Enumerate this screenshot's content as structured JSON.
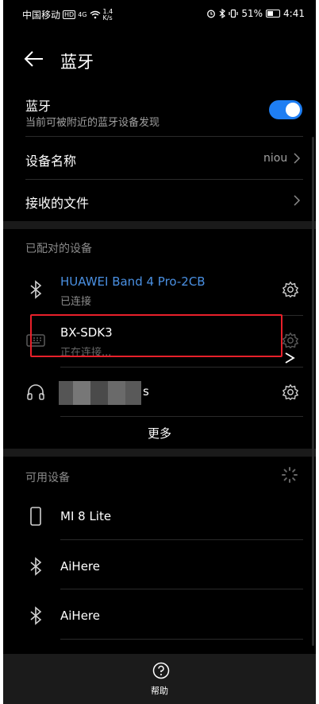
{
  "status_bar": {
    "carrier": "中国移动",
    "hd": "HD",
    "network": "4G",
    "speed_value": "1.4",
    "speed_unit": "K/s",
    "battery": "51%",
    "time": "4:41"
  },
  "header": {
    "title": "蓝牙"
  },
  "bluetooth_toggle": {
    "label": "蓝牙",
    "description": "当前可被附近的蓝牙设备发现",
    "enabled": true
  },
  "device_name": {
    "label": "设备名称",
    "value": "niou"
  },
  "received_files": {
    "label": "接收的文件"
  },
  "paired": {
    "title": "已配对的设备",
    "devices": [
      {
        "name": "HUAWEI Band 4 Pro-2CB",
        "status": "已连接",
        "icon": "bluetooth-icon",
        "color": "#4a90e2"
      },
      {
        "name": "BX-SDK3",
        "status": "正在连接...",
        "icon": "keyboard-icon",
        "color": "#ffffff"
      },
      {
        "name": "s",
        "status": "",
        "icon": "headset-icon",
        "color": "#ffffff"
      }
    ],
    "more_label": "更多"
  },
  "available": {
    "title": "可用设备",
    "devices": [
      {
        "name": "MI 8 Lite",
        "icon": "phone-icon"
      },
      {
        "name": "AiHere",
        "icon": "bluetooth-icon"
      },
      {
        "name": "AiHere",
        "icon": "bluetooth-icon"
      }
    ]
  },
  "bottom": {
    "help_label": "帮助"
  },
  "colors": {
    "accent": "#1e7ef3",
    "highlight": "#e8202a",
    "connected_name": "#4a90e2"
  }
}
